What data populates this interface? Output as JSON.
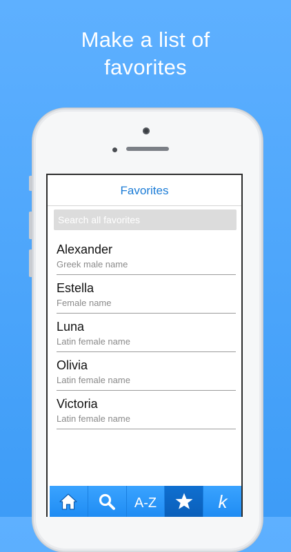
{
  "headline": {
    "line1": "Make a list of",
    "line2": "favorites"
  },
  "screen": {
    "title": "Favorites",
    "search_placeholder": "Search all favorites"
  },
  "favorites": [
    {
      "name": "Alexander",
      "description": "Greek male name"
    },
    {
      "name": "Estella",
      "description": "Female name"
    },
    {
      "name": "Luna",
      "description": "Latin female name"
    },
    {
      "name": "Olivia",
      "description": "Latin female name"
    },
    {
      "name": "Victoria",
      "description": "Latin female name"
    }
  ],
  "tabbar": {
    "tabs": [
      {
        "icon": "home-icon"
      },
      {
        "icon": "search-icon"
      },
      {
        "icon": "a-z-icon",
        "label": "A-Z"
      },
      {
        "icon": "star-icon",
        "active": true
      },
      {
        "icon": "k-logo-icon",
        "label": "k"
      }
    ]
  },
  "colors": {
    "background": "#4aa5fb",
    "title_blue": "#1a7bd6",
    "tab_blue": "#2b96f7",
    "tab_active": "#0d68c6"
  }
}
